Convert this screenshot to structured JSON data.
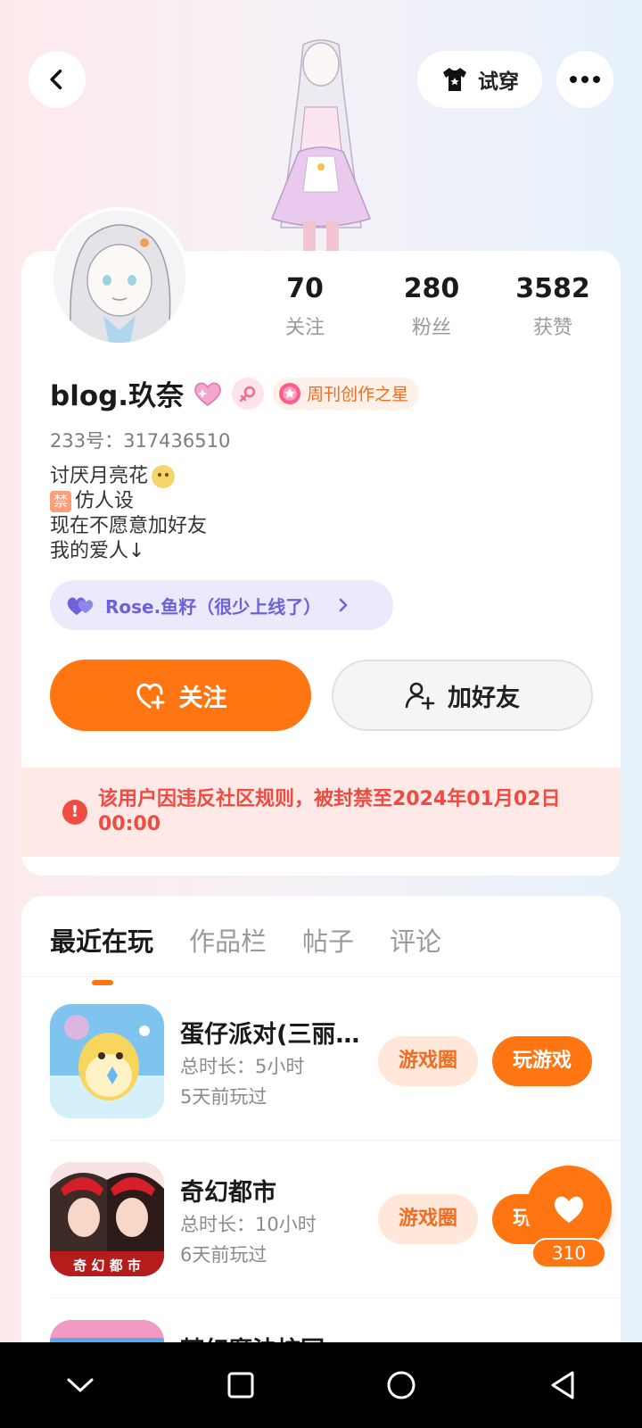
{
  "header": {
    "tryon_label": "试穿"
  },
  "stats": [
    {
      "value": "70",
      "label": "关注"
    },
    {
      "value": "280",
      "label": "粉丝"
    },
    {
      "value": "3582",
      "label": "获赞"
    }
  ],
  "profile": {
    "name": "blog.玖奈",
    "badge_label": "周刊创作之星",
    "uid": "233号：317436510",
    "bio": [
      "讨厌月亮花",
      "仿人设",
      "现在不愿意加好友",
      "我的爱人↓"
    ],
    "ban_chip": "禁",
    "couple_name": "Rose.鱼籽（很少上线了）"
  },
  "actions": {
    "follow_label": "关注",
    "add_friend_label": "加好友"
  },
  "ban_notice": {
    "icon": "!",
    "text": "该用户因违反社区规则，被封禁至2024年01月02日 00:00"
  },
  "tabs": [
    "最近在玩",
    "作品栏",
    "帖子",
    "评论"
  ],
  "games": [
    {
      "title": "蛋仔派对(三丽…",
      "duration": "总时长：5小时",
      "last_played": "5天前玩过",
      "circle_label": "游戏圈",
      "play_label": "玩游戏"
    },
    {
      "title": "奇幻都市",
      "duration": "总时长：10小时",
      "last_played": "6天前玩过",
      "circle_label": "游戏圈",
      "play_label": "玩游戏",
      "icon_text": "奇 幻 都 市"
    },
    {
      "title": "梦幻魔法校园"
    }
  ],
  "like": {
    "count": "310"
  },
  "colors": {
    "accent": "#ff7512",
    "ban_red": "#ee4b43",
    "couple_purple": "#6d62d8"
  }
}
